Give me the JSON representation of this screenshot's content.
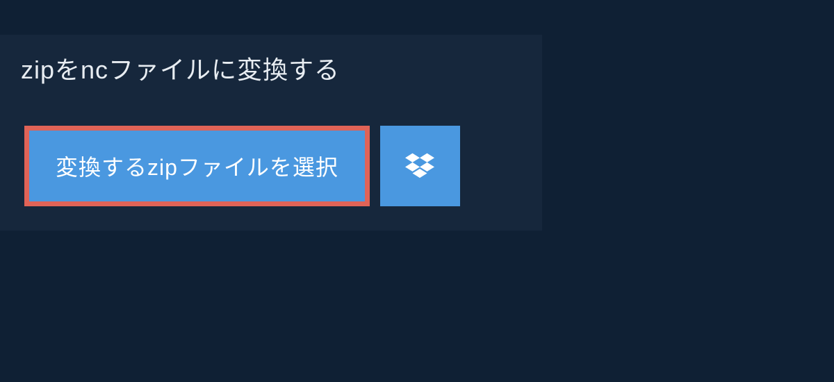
{
  "header": {
    "title": "zipをncファイルに変換する"
  },
  "actions": {
    "select_file_label": "変換するzipファイルを選択",
    "dropbox_icon": "dropbox"
  }
}
